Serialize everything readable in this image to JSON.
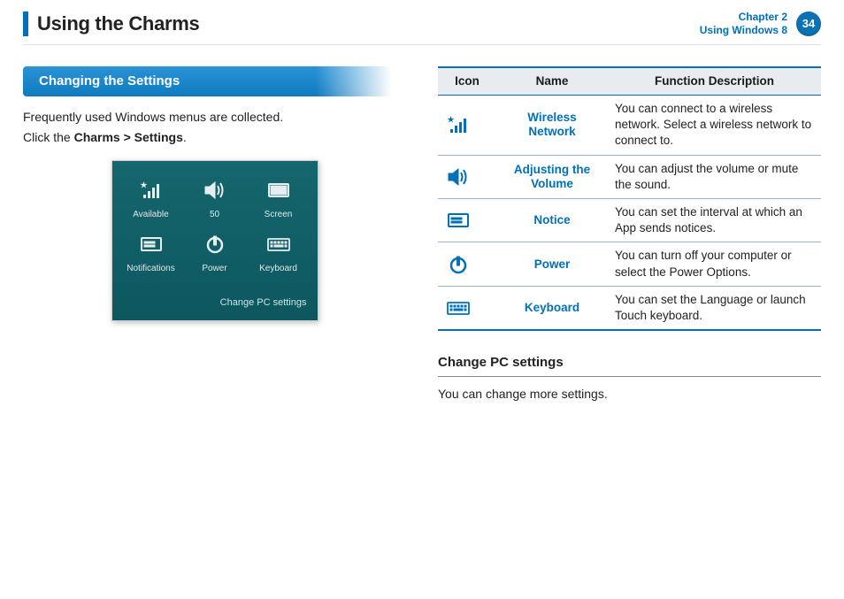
{
  "header": {
    "title": "Using the Charms",
    "chapter_line1": "Chapter 2",
    "chapter_line2": "Using Windows 8",
    "page_number": "34"
  },
  "left": {
    "section_title": "Changing the Settings",
    "intro": "Frequently used Windows menus are collected.",
    "instr_prefix": "Click the ",
    "instr_path": "Charms > Settings",
    "instr_suffix": ".",
    "panel": {
      "tiles": [
        {
          "label": "Available",
          "icon": "wifi"
        },
        {
          "label": "50",
          "icon": "volume"
        },
        {
          "label": "Screen",
          "icon": "screen"
        },
        {
          "label": "Notifications",
          "icon": "notice"
        },
        {
          "label": "Power",
          "icon": "power"
        },
        {
          "label": "Keyboard",
          "icon": "keyboard"
        }
      ],
      "footer": "Change PC settings"
    }
  },
  "right": {
    "table_headers": {
      "icon": "Icon",
      "name": "Name",
      "fn": "Function Description"
    },
    "rows": [
      {
        "icon": "wifi",
        "name": "Wireless Network",
        "fn": "You can connect to a wireless network. Select a wireless network to connect to."
      },
      {
        "icon": "volume",
        "name": "Adjusting the Volume",
        "fn": "You can adjust the volume or mute the sound."
      },
      {
        "icon": "notice",
        "name": "Notice",
        "fn": "You can set the interval at which an App sends notices."
      },
      {
        "icon": "power",
        "name": "Power",
        "fn": "You can turn off your computer or select the Power Options."
      },
      {
        "icon": "keyboard",
        "name": "Keyboard",
        "fn": "You can set the Language or launch Touch keyboard."
      }
    ],
    "subhead": "Change PC settings",
    "subtext": "You can change more settings."
  }
}
